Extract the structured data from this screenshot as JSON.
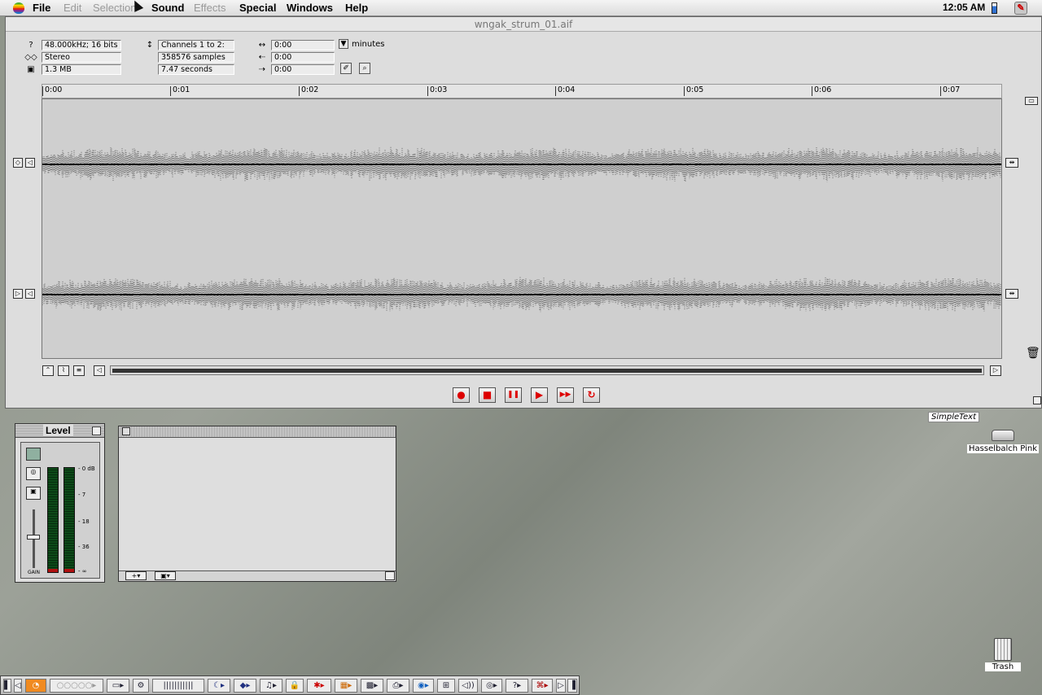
{
  "menubar": {
    "items": [
      {
        "label": "File",
        "enabled": true
      },
      {
        "label": "Edit",
        "enabled": false
      },
      {
        "label": "Selection",
        "enabled": false
      },
      {
        "label": "Sound",
        "enabled": true
      },
      {
        "label": "Effects",
        "enabled": false
      },
      {
        "label": "Special",
        "enabled": true
      },
      {
        "label": "Windows",
        "enabled": true
      },
      {
        "label": "Help",
        "enabled": true
      }
    ],
    "clock": "12:05 AM"
  },
  "sound_window": {
    "title": "wngak_strum_01.aif",
    "info": {
      "format": "48.000kHz; 16 bits",
      "channel_mode": "Stereo",
      "file_size": "1.3 MB",
      "channels": "Channels 1 to 2:",
      "samples": "358576 samples",
      "duration": "7.47 seconds",
      "selection_length": "0:00",
      "selection_start": "0:00",
      "selection_end": "0:00",
      "time_unit": "minutes"
    },
    "ruler_ticks": [
      "0:00",
      "0:01",
      "0:02",
      "0:03",
      "0:04",
      "0:05",
      "0:06",
      "0:07"
    ],
    "transport": {
      "record": "●",
      "stop": "■",
      "pause": "❚❚",
      "play": "▶",
      "fast_forward": "▶▶",
      "loop": "↻"
    }
  },
  "level_window": {
    "title": "Level",
    "scale": [
      "- 0 dB",
      "- 7",
      "- 18",
      "- 36",
      "- ∞"
    ],
    "gain_label": "GAIN"
  },
  "desktop": {
    "simpletext_label": "SimpleText",
    "drive_label": "Hasselbalch Pink",
    "trash_label": "Trash"
  },
  "colors": {
    "transport_red": "#dd0000",
    "meter_green": "#0d4a18"
  }
}
